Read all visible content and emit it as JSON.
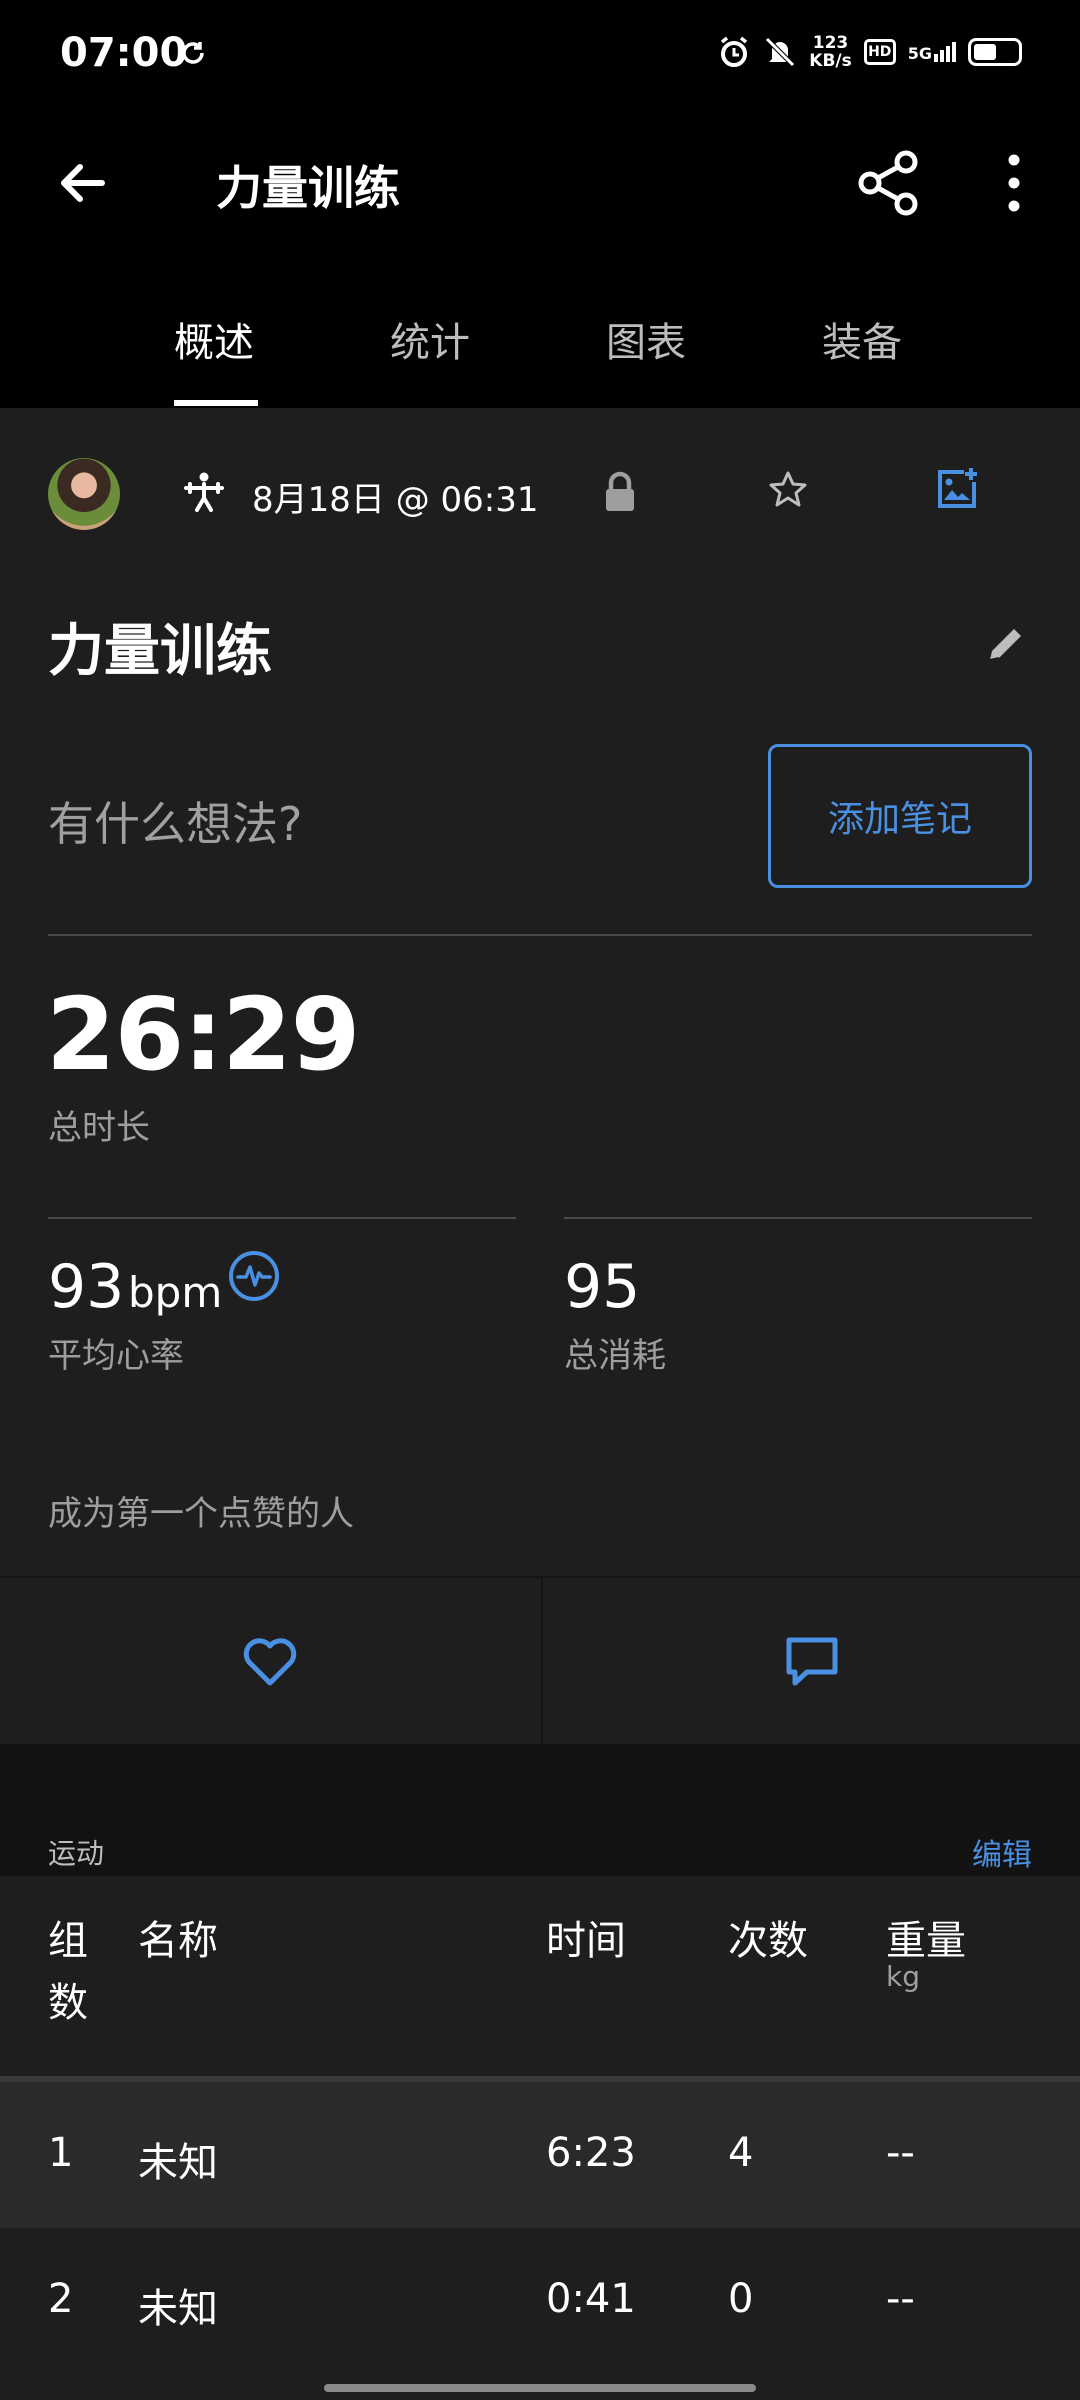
{
  "status_bar": {
    "time": "07:00",
    "speed_top": "123",
    "speed_bottom": "KB/s",
    "hd": "HD",
    "network": "5G"
  },
  "app_bar": {
    "title": "力量训练"
  },
  "tabs": [
    {
      "label": "概述",
      "active": true
    },
    {
      "label": "统计",
      "active": false
    },
    {
      "label": "图表",
      "active": false
    },
    {
      "label": "装备",
      "active": false
    }
  ],
  "activity": {
    "date": "8月18日 @ 06:31",
    "title": "力量训练",
    "thoughts_placeholder": "有什么想法?",
    "add_note_label": "添加笔记"
  },
  "stats": {
    "duration_value": "26:29",
    "duration_label": "总时长",
    "avg_hr_value": "93",
    "avg_hr_unit": "bpm",
    "avg_hr_label": "平均心率",
    "calories_value": "95",
    "calories_label": "总消耗"
  },
  "social": {
    "first_like_text": "成为第一个点赞的人"
  },
  "exercises": {
    "section_label": "运动",
    "edit_label": "编辑",
    "columns": {
      "set_line1": "组",
      "set_line2": "数",
      "name": "名称",
      "time": "时间",
      "reps": "次数",
      "weight": "重量",
      "weight_unit": "kg"
    },
    "rows": [
      {
        "set": "1",
        "name": "未知",
        "time": "6:23",
        "reps": "4",
        "weight": "--"
      },
      {
        "set": "2",
        "name": "未知",
        "time": "0:41",
        "reps": "0",
        "weight": "--"
      }
    ]
  },
  "colors": {
    "accent": "#4a90e2",
    "background": "#1e1e1e",
    "header": "#000000"
  }
}
